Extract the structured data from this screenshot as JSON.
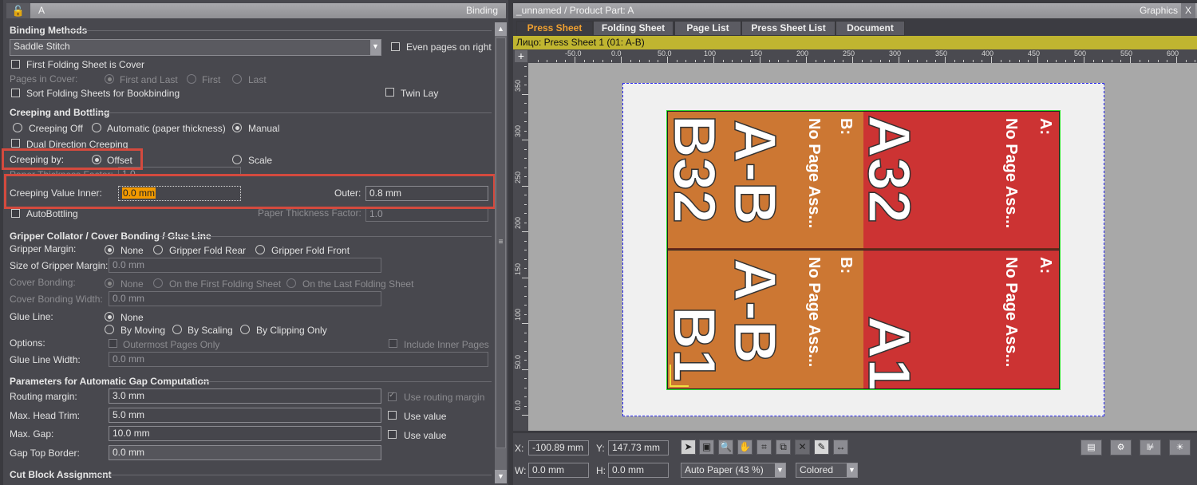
{
  "left_panel": {
    "title": "A",
    "panel_name": "Binding",
    "binding_methods": {
      "header": "Binding Methods",
      "method_value": "Saddle Stitch",
      "even_pages_on_right": {
        "label": "Even pages on right",
        "checked": false
      },
      "first_folding_sheet_cover": {
        "label": "First Folding Sheet is Cover",
        "checked": false
      },
      "pages_in_cover": {
        "label": "Pages in Cover:",
        "options": [
          "First and Last",
          "First",
          "Last"
        ],
        "selected": "First and Last"
      },
      "sort_folding_sheets": {
        "label": "Sort Folding Sheets for Bookbinding",
        "checked": false
      },
      "twin_lay": {
        "label": "Twin Lay",
        "checked": false
      }
    },
    "creeping": {
      "header": "Creeping and Bottling",
      "modes": [
        "Creeping Off",
        "Automatic (paper thickness)",
        "Manual"
      ],
      "selected_mode": "Manual",
      "dual_direction": {
        "label": "Dual Direction Creeping",
        "checked": false
      },
      "creeping_by_label": "Creeping by:",
      "creeping_by_options": [
        "Offset",
        "Scale"
      ],
      "creeping_by_selected": "Offset",
      "hidden_ptf_label": "Paper Thickness Factor:",
      "hidden_ptf_value": "1.0",
      "inner_label": "Creeping Value Inner:",
      "inner_value": "0.0 mm",
      "outer_label": "Outer:",
      "outer_value": "0.8 mm",
      "autobottling": {
        "label": "AutoBottling",
        "checked": false
      },
      "ptf_label": "Paper Thickness Factor:",
      "ptf_value": "1.0"
    },
    "gripper": {
      "header": "Gripper Collator / Cover Bonding / Glue Line",
      "gripper_margin_label": "Gripper Margin:",
      "gripper_margin_options": [
        "None",
        "Gripper Fold Rear",
        "Gripper Fold Front"
      ],
      "gripper_margin_selected": "None",
      "size_label": "Size of Gripper Margin:",
      "size_value": "0.0 mm",
      "cover_bonding_label": "Cover Bonding:",
      "cover_bonding_options": [
        "None",
        "On the First Folding Sheet",
        "On the Last Folding Sheet"
      ],
      "cover_bonding_selected": "None",
      "cover_bonding_width_label": "Cover Bonding Width:",
      "cover_bonding_width_value": "0.0 mm",
      "glue_line_label": "Glue Line:",
      "glue_line_options": [
        "None",
        "By Moving",
        "By Scaling",
        "By Clipping Only"
      ],
      "glue_line_selected": "None",
      "options_label": "Options:",
      "outermost": {
        "label": "Outermost Pages Only",
        "checked": false
      },
      "include_inner": {
        "label": "Include Inner Pages",
        "checked": false
      },
      "glue_width_label": "Glue Line Width:",
      "glue_width_value": "0.0 mm"
    },
    "gap": {
      "header": "Parameters for Automatic Gap Computation",
      "routing_label": "Routing margin:",
      "routing_value": "3.0 mm",
      "use_routing": {
        "label": "Use routing margin",
        "checked": true
      },
      "head_trim_label": "Max. Head Trim:",
      "head_trim_value": "5.0 mm",
      "head_trim_use": {
        "label": "Use value",
        "checked": false
      },
      "max_gap_label": "Max. Gap:",
      "max_gap_value": "10.0 mm",
      "max_gap_use": {
        "label": "Use value",
        "checked": false
      },
      "gap_top_label": "Gap Top Border:",
      "gap_top_value": "0.0 mm"
    },
    "cut_block": {
      "header": "Cut Block Assignment"
    }
  },
  "right_panel": {
    "title": "_unnamed / Product Part: A",
    "panel_name": "Graphics",
    "close": "X",
    "tabs": [
      {
        "label": "Press Sheet",
        "active": true
      },
      {
        "label": "Folding Sheet",
        "active": false
      },
      {
        "label": "Page List",
        "active": false
      },
      {
        "label": "Press Sheet List",
        "active": false
      },
      {
        "label": "Document",
        "active": false
      }
    ],
    "sheet_bar": "Лицо:  Press Sheet 1 (01: A-B)",
    "h_ruler_labels": [
      "-50.0",
      "0.0",
      "50.0",
      "100",
      "150",
      "200",
      "250",
      "300",
      "350",
      "400",
      "450",
      "500",
      "550",
      "600"
    ],
    "v_ruler_labels": [
      "350",
      "300",
      "250",
      "200",
      "150",
      "100",
      "50.0",
      "0.0"
    ],
    "pages": [
      {
        "part_a_label": "A:",
        "part_a_text": "No Page Ass...",
        "part_a_page": "A32",
        "part_b_label": "B:",
        "part_b_text": "No Page Ass...",
        "part_b_name": "A-B",
        "part_b_page": "B32"
      },
      {
        "part_a_label": "A:",
        "part_a_text": "No Page Ass...",
        "part_a_page": "A1",
        "part_b_label": "B:",
        "part_b_text": "No Page Ass...",
        "part_b_name": "A-B",
        "part_b_page": "B1"
      }
    ],
    "colors": {
      "part_a": "#cc3333",
      "part_b": "#cc7733",
      "sheet_bar": "#c0b530",
      "active_tab": "#f0a030"
    },
    "toolbar": {
      "x_label": "X:",
      "x_value": "-100.89 mm",
      "y_label": "Y:",
      "y_value": "147.73 mm",
      "w_label": "W:",
      "w_value": "0.0 mm",
      "h_label": "H:",
      "h_value": "0.0 mm",
      "zoom_value": "Auto Paper (43 %)",
      "color_mode": "Colored"
    }
  }
}
